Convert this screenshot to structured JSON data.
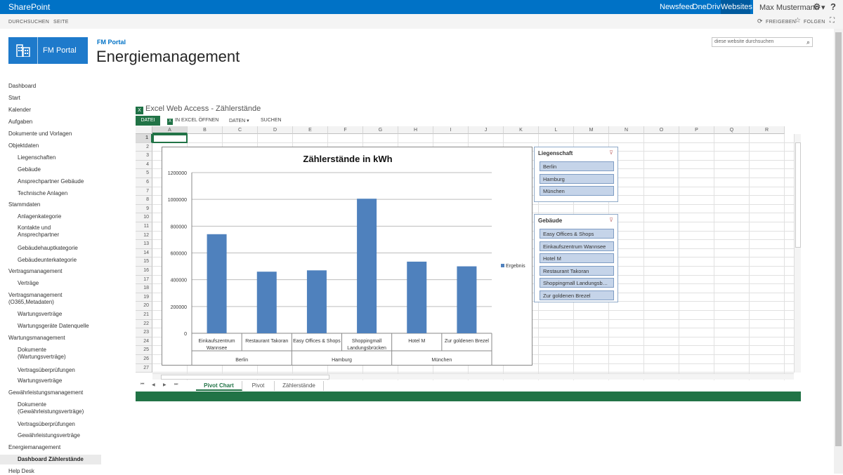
{
  "topbar": {
    "brand": "SharePoint",
    "links": [
      "Newsfeed",
      "OneDrive",
      "Websites"
    ],
    "user": "Max Mustermann ▾"
  },
  "ribbon": {
    "left": [
      "DURCHSUCHEN",
      "SEITE"
    ],
    "share": "FREIGEBEN",
    "follow": "FOLGEN"
  },
  "site": {
    "logo_text": "FM Portal",
    "breadcrumb": "FM Portal",
    "title": "Energiemanagement",
    "search_placeholder": "diese website durchsuchen"
  },
  "nav": [
    {
      "label": "Dashboard",
      "level": 0
    },
    {
      "label": "Start",
      "level": 0
    },
    {
      "label": "Kalender",
      "level": 0
    },
    {
      "label": "Aufgaben",
      "level": 0
    },
    {
      "label": "Dokumente und Vorlagen",
      "level": 0
    },
    {
      "label": "Objektdaten",
      "level": 0
    },
    {
      "label": "Liegenschaften",
      "level": 1
    },
    {
      "label": "Gebäude",
      "level": 1
    },
    {
      "label": "Ansprechpartner Gebäude",
      "level": 1
    },
    {
      "label": "Technische Anlagen",
      "level": 1
    },
    {
      "label": "Stammdaten",
      "level": 0
    },
    {
      "label": "Anlagenkategorie",
      "level": 1
    },
    {
      "label": "Kontakte und\nAnsprechpartner",
      "level": 1
    },
    {
      "label": "Gebäudehauptkategorie",
      "level": 1
    },
    {
      "label": "Gebäudeunterkategorie",
      "level": 1
    },
    {
      "label": "Vertragsmanagement",
      "level": 0
    },
    {
      "label": "Verträge",
      "level": 1
    },
    {
      "label": "Vertragsmanagement\n(O365,Metadaten)",
      "level": 0
    },
    {
      "label": "Wartungsverträge",
      "level": 1
    },
    {
      "label": "Wartungsgeräte Datenquelle",
      "level": 1
    },
    {
      "label": "Wartungsmanagement",
      "level": 0
    },
    {
      "label": "Dokumente\n(Wartungsverträge)",
      "level": 1
    },
    {
      "label": "Vertragsüberprüfungen",
      "level": 1
    },
    {
      "label": "Wartungsverträge",
      "level": 1
    },
    {
      "label": "Gewährleistungsmanagement",
      "level": 0
    },
    {
      "label": "Dokumente\n(Gewährleistungsverträge)",
      "level": 1
    },
    {
      "label": "Vertragsüberprüfungen",
      "level": 1
    },
    {
      "label": "Gewährleistungsverträge",
      "level": 1
    },
    {
      "label": "Energiemanagement",
      "level": 0
    },
    {
      "label": "Dashboard Zählerstände",
      "level": 1,
      "selected": true
    },
    {
      "label": "Help Desk",
      "level": 0
    }
  ],
  "ewa": {
    "title": "Excel Web Access - Zählerstände",
    "tools": [
      "DATEI",
      "IN EXCEL ÖFFNEN",
      "DATEN ▾",
      "SUCHEN"
    ],
    "xl": "X"
  },
  "grid": {
    "columns": [
      "A",
      "B",
      "C",
      "D",
      "E",
      "F",
      "G",
      "H",
      "I",
      "J",
      "K",
      "L",
      "M",
      "N",
      "O",
      "P",
      "Q",
      "R"
    ],
    "rows": [
      "1",
      "2",
      "3",
      "4",
      "5",
      "6",
      "7",
      "8",
      "9",
      "10",
      "11",
      "12",
      "13",
      "14",
      "15",
      "16",
      "17",
      "18",
      "19",
      "20",
      "21",
      "22",
      "23",
      "24",
      "25",
      "26",
      "27"
    ]
  },
  "chart_data": {
    "type": "bar",
    "title": "Zählerstände in kWh",
    "categories": [
      "Einkaufszentrum Wannsee",
      "Restaurant Takoran",
      "Easy Offices & Shops",
      "Shoppingmall Landungsbrücken",
      "Hotel M",
      "Zur goldenen Brezel"
    ],
    "category_labels": [
      [
        "Einkaufszentrum",
        "Wannsee"
      ],
      [
        "Restaurant Takoran"
      ],
      [
        "Easy Offices & Shops"
      ],
      [
        "Shoppingmall",
        "Landungsbrücken"
      ],
      [
        "Hotel M"
      ],
      [
        "Zur goldenen Brezel"
      ]
    ],
    "groups": [
      {
        "label": "Berlin",
        "count": 2
      },
      {
        "label": "Hamburg",
        "count": 2
      },
      {
        "label": "München",
        "count": 2
      }
    ],
    "series": [
      {
        "name": "Ergebnis",
        "values": [
          740000,
          460000,
          470000,
          1005000,
          535000,
          500000
        ],
        "color": "#4f81bd"
      }
    ],
    "yticks": [
      "0",
      "200000",
      "400000",
      "600000",
      "800000",
      "1000000",
      "1200000"
    ],
    "ylim": [
      0,
      1200000
    ],
    "grid": true,
    "legend": "right"
  },
  "slicers": [
    {
      "title": "Liegenschaft",
      "items": [
        "Berlin",
        "Hamburg",
        "München"
      ]
    },
    {
      "title": "Gebäude",
      "items": [
        "Easy Offices & Shops",
        "Einkaufszentrum Wannsee",
        "Hotel M",
        "Restaurant Takoran",
        "Shoppingmall Landungsb…",
        "Zur goldenen Brezel"
      ]
    }
  ],
  "sheets": {
    "tabs": [
      "Pivot Chart",
      "Pivot",
      "Zählerstände"
    ],
    "active": 0
  }
}
